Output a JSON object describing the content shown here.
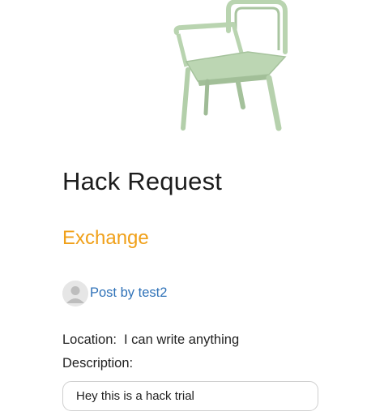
{
  "product": {
    "image_icon": "chair-image"
  },
  "request": {
    "title": "Hack Request",
    "category": "Exchange",
    "author_prefix": "Post by",
    "author_name": "test2",
    "author_text": "Post by test2",
    "location_label": "Location:",
    "location_value": "I can write anything",
    "description_label": "Description:",
    "description_value": "Hey this is a hack trial"
  },
  "colors": {
    "category": "#f0a019",
    "link": "#2f72b8",
    "chair": "#b9d4b0"
  }
}
